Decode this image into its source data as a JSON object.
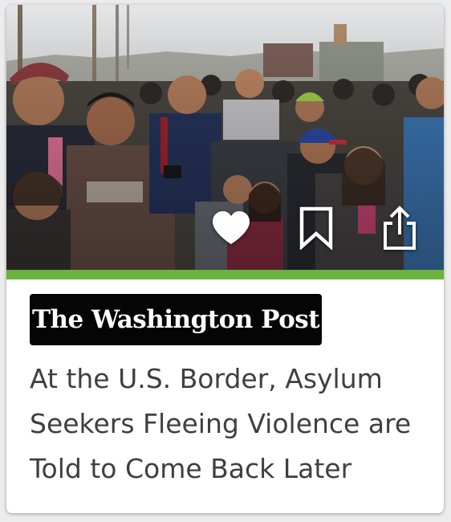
{
  "card": {
    "photo_alt": "Crowd of asylum seekers walking at the U.S. border",
    "actions": [
      {
        "name": "like",
        "icon": "heart-icon"
      },
      {
        "name": "save",
        "icon": "bookmark-icon"
      },
      {
        "name": "share",
        "icon": "share-icon"
      }
    ],
    "accent_color": "#6bb33e",
    "publisher": "The Washington Post",
    "headline": "At the U.S. Border, Asylum Seekers Fleeing Violence are Told to Come Back Later"
  }
}
